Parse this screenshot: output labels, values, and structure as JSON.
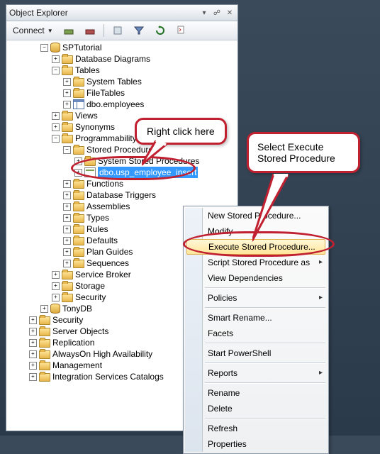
{
  "panel": {
    "title": "Object Explorer"
  },
  "toolbar": {
    "connect_label": "Connect"
  },
  "tree": {
    "db": "SPTutorial",
    "database_diagrams": "Database Diagrams",
    "tables": "Tables",
    "system_tables": "System Tables",
    "file_tables": "FileTables",
    "dbo_employees": "dbo.employees",
    "views": "Views",
    "synonyms": "Synonyms",
    "programmability": "Programmability",
    "stored_procedures": "Stored Procedures",
    "system_stored_procedures": "System Stored Procedures",
    "usp_employee_insert": "dbo.usp_employee_insert",
    "functions": "Functions",
    "database_triggers": "Database Triggers",
    "assemblies": "Assemblies",
    "types": "Types",
    "rules": "Rules",
    "defaults": "Defaults",
    "plan_guides": "Plan Guides",
    "sequences": "Sequences",
    "service_broker": "Service Broker",
    "storage": "Storage",
    "security_inner": "Security",
    "tonydb": "TonyDB",
    "security": "Security",
    "server_objects": "Server Objects",
    "replication": "Replication",
    "alwayson": "AlwaysOn High Availability",
    "management": "Management",
    "integration": "Integration Services Catalogs"
  },
  "menu": {
    "new_sp": "New Stored Procedure...",
    "modify": "Modify",
    "execute": "Execute Stored Procedure...",
    "script_as": "Script Stored Procedure as",
    "view_deps": "View Dependencies",
    "policies": "Policies",
    "smart_rename": "Smart Rename...",
    "facets": "Facets",
    "powershell": "Start PowerShell",
    "reports": "Reports",
    "rename": "Rename",
    "delete": "Delete",
    "refresh": "Refresh",
    "properties": "Properties"
  },
  "callouts": {
    "right_click": "Right click here",
    "select_exec_l1": "Select Execute",
    "select_exec_l2": "Stored Procedure"
  }
}
